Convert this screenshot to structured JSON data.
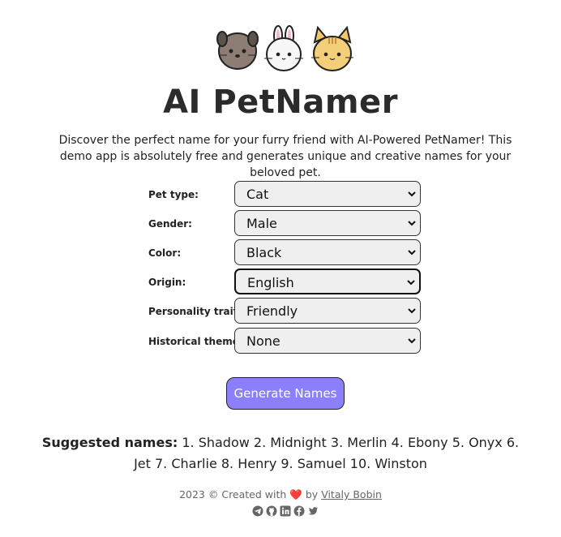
{
  "header": {
    "title": "AI PetNamer",
    "description": "Discover the perfect name for your furry friend with AI-Powered PetNamer! This demo app is absolutely free and generates unique and creative names for your beloved pet.",
    "logo_icons": [
      "puppy-icon",
      "bunny-icon",
      "kitten-icon"
    ]
  },
  "form": {
    "fields": [
      {
        "label": "Pet type:",
        "value": "Cat"
      },
      {
        "label": "Gender:",
        "value": "Male"
      },
      {
        "label": "Color:",
        "value": "Black"
      },
      {
        "label": "Origin:",
        "value": "English"
      },
      {
        "label": "Personality traits:",
        "value": "Friendly"
      },
      {
        "label": "Historical themes:",
        "value": "None"
      }
    ],
    "submit_label": "Generate Names"
  },
  "results": {
    "label": "Suggested names:",
    "text": "1. Shadow 2. Midnight 3. Merlin 4. Ebony 5. Onyx 6. Jet 7. Charlie 8. Henry 9. Samuel 10. Winston"
  },
  "footer": {
    "prefix": "2023 © Created with",
    "heart": "❤️",
    "by": "by",
    "author": "Vitaly Bobin",
    "social_icons": [
      "telegram-icon",
      "github-icon",
      "linkedin-icon",
      "facebook-icon",
      "twitter-icon"
    ]
  },
  "colors": {
    "button_bg": "#8b80f9",
    "select_bg": "#efefef",
    "heart": "#e0242f"
  }
}
